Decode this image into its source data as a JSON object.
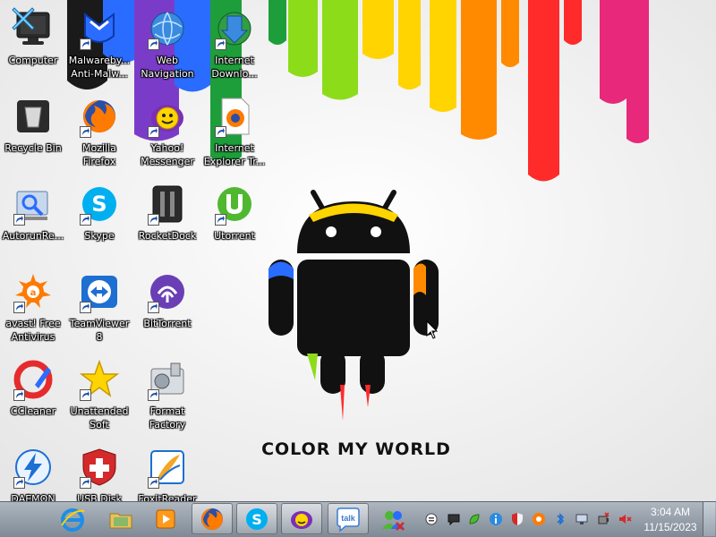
{
  "wallpaper": {
    "caption": "COLOR MY WORLD",
    "paint_colors": [
      "#1a1a1a",
      "#2a6cff",
      "#7a3cc8",
      "#1e9e3a",
      "#8ddc1a",
      "#ffd400",
      "#ff8a00",
      "#ff2a2a",
      "#e8287a"
    ]
  },
  "desktop_icons": [
    {
      "label": "Computer",
      "icon": "computer-icon",
      "shortcut": false
    },
    {
      "label": "Malwareby... Anti-Malw...",
      "icon": "malwarebytes-icon",
      "shortcut": true
    },
    {
      "label": "Web Navigation",
      "icon": "globe-icon",
      "shortcut": true
    },
    {
      "label": "Internet Downlo...",
      "icon": "download-manager-icon",
      "shortcut": true
    },
    {
      "label": "Recycle Bin",
      "icon": "recycle-bin-icon",
      "shortcut": false
    },
    {
      "label": "Mozilla Firefox",
      "icon": "firefox-icon",
      "shortcut": true
    },
    {
      "label": "Yahoo! Messenger",
      "icon": "yahoo-messenger-icon",
      "shortcut": true
    },
    {
      "label": "Internet Explorer Tr...",
      "icon": "document-firefox-icon",
      "shortcut": true
    },
    {
      "label": "AutorunRe...",
      "icon": "autorun-icon",
      "shortcut": true
    },
    {
      "label": "Skype",
      "icon": "skype-icon",
      "shortcut": true
    },
    {
      "label": "RocketDock",
      "icon": "rocketdock-icon",
      "shortcut": true
    },
    {
      "label": "Utorrent",
      "icon": "utorrent-icon",
      "shortcut": true
    },
    {
      "label": "avast! Free Antivirus",
      "icon": "avast-icon",
      "shortcut": true
    },
    {
      "label": "TeamViewer 8",
      "icon": "teamviewer-icon",
      "shortcut": true
    },
    {
      "label": "BitTorrent",
      "icon": "bittorrent-icon",
      "shortcut": true
    },
    {
      "label": "CCleaner",
      "icon": "ccleaner-icon",
      "shortcut": true
    },
    {
      "label": "Unattended Soft",
      "icon": "star-icon",
      "shortcut": true
    },
    {
      "label": "Format Factory",
      "icon": "format-factory-icon",
      "shortcut": true
    },
    {
      "label": "DAEMON",
      "icon": "daemon-tools-icon",
      "shortcut": true
    },
    {
      "label": "USB Disk",
      "icon": "usb-disk-security-icon",
      "shortcut": true
    },
    {
      "label": "FoxitReader",
      "icon": "foxit-reader-icon",
      "shortcut": true
    }
  ],
  "taskbar": {
    "start_icon": "start-x-icon",
    "buttons": [
      {
        "icon": "internet-explorer-icon",
        "active": false
      },
      {
        "icon": "explorer-folder-icon",
        "active": false
      },
      {
        "icon": "media-player-icon",
        "active": false
      },
      {
        "icon": "firefox-icon",
        "active": true
      },
      {
        "icon": "skype-icon",
        "active": true
      },
      {
        "icon": "yahoo-messenger-icon",
        "active": true
      },
      {
        "icon": "google-talk-icon",
        "active": true
      },
      {
        "icon": "network-users-icon",
        "active": false
      }
    ],
    "google_talk_text": "talk"
  },
  "tray": {
    "icons": [
      "chat-bubble-icon",
      "messages-icon",
      "green-leaf-icon",
      "info-icon",
      "shield-icon",
      "avast-tray-icon",
      "bluetooth-icon",
      "monitor-icon",
      "power-icon",
      "volume-muted-icon"
    ],
    "time": "3:04 AM",
    "date": "11/15/2023"
  },
  "colors": {
    "taskbar_top": "#aeb6bf",
    "taskbar_bottom": "#7f8a96",
    "label_text": "#ffffff"
  }
}
